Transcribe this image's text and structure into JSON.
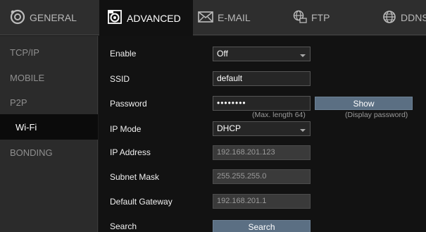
{
  "tabs": {
    "general": "GENERAL",
    "advanced": "ADVANCED",
    "email": "E-MAIL",
    "ftp": "FTP",
    "ddns": "DDNS"
  },
  "sidebar": {
    "items": [
      {
        "label": "TCP/IP"
      },
      {
        "label": "MOBILE"
      },
      {
        "label": "P2P"
      },
      {
        "label": "Wi-Fi",
        "active": true
      },
      {
        "label": "BONDING"
      }
    ]
  },
  "form": {
    "enable": {
      "label": "Enable",
      "value": "Off"
    },
    "ssid": {
      "label": "SSID",
      "value": "default"
    },
    "password": {
      "label": "Password",
      "value": "••••••••",
      "hint": "(Max. length 64)"
    },
    "show": {
      "label": "Show",
      "hint": "(Display password)"
    },
    "ip_mode": {
      "label": "IP Mode",
      "value": "DHCP"
    },
    "ip_address": {
      "label": "IP Address",
      "value": "192.168.201.123"
    },
    "subnet_mask": {
      "label": "Subnet Mask",
      "value": "255.255.255.0"
    },
    "default_gateway": {
      "label": "Default Gateway",
      "value": "192.168.201.1"
    },
    "search": {
      "label": "Search",
      "button": "Search"
    }
  },
  "colors": {
    "accent_button": "#5b6f83",
    "background": "#121212",
    "sidebar": "#2b2b2b"
  }
}
